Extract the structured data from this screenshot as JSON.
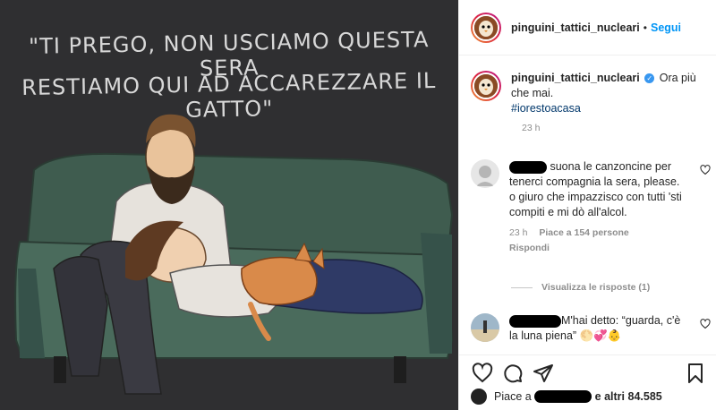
{
  "photo": {
    "caption_line_1": "\"TI PREGO, NON USCIAMO QUESTA SERA",
    "caption_line_2": "RESTIAMO QUI AD ACCAREZZARE IL GATTO\""
  },
  "header": {
    "username": "pinguini_tattici_nucleari",
    "dot": "•",
    "follow_label": "Segui"
  },
  "post": {
    "username": "pinguini_tattici_nucleari",
    "verified_icon": "✓",
    "caption": "Ora più che mai.",
    "hashtag": "#iorestoacasa",
    "time": "23 h"
  },
  "comments": [
    {
      "text": "suona le canzoncine per tenerci compagnia la sera, please. o giuro che impazzisco con tutti 'sti compiti e mi dò all'alcol.",
      "time": "23 h",
      "likes": "Piace a 154 persone",
      "reply_label": "Rispondi"
    },
    {
      "text": "M'hai detto: “guarda, c'è la luna piena” 🌕💞👶"
    }
  ],
  "replies_label": "Visualizza le risposte (1)",
  "likes": {
    "prefix": "Piace a",
    "suffix": "e altri 84.585"
  },
  "colors": {
    "accent": "#0095f6",
    "hashtag": "#00376b",
    "muted": "#8e8e8e"
  },
  "icons": [
    "heart-icon",
    "comment-icon",
    "share-icon",
    "bookmark-icon"
  ]
}
